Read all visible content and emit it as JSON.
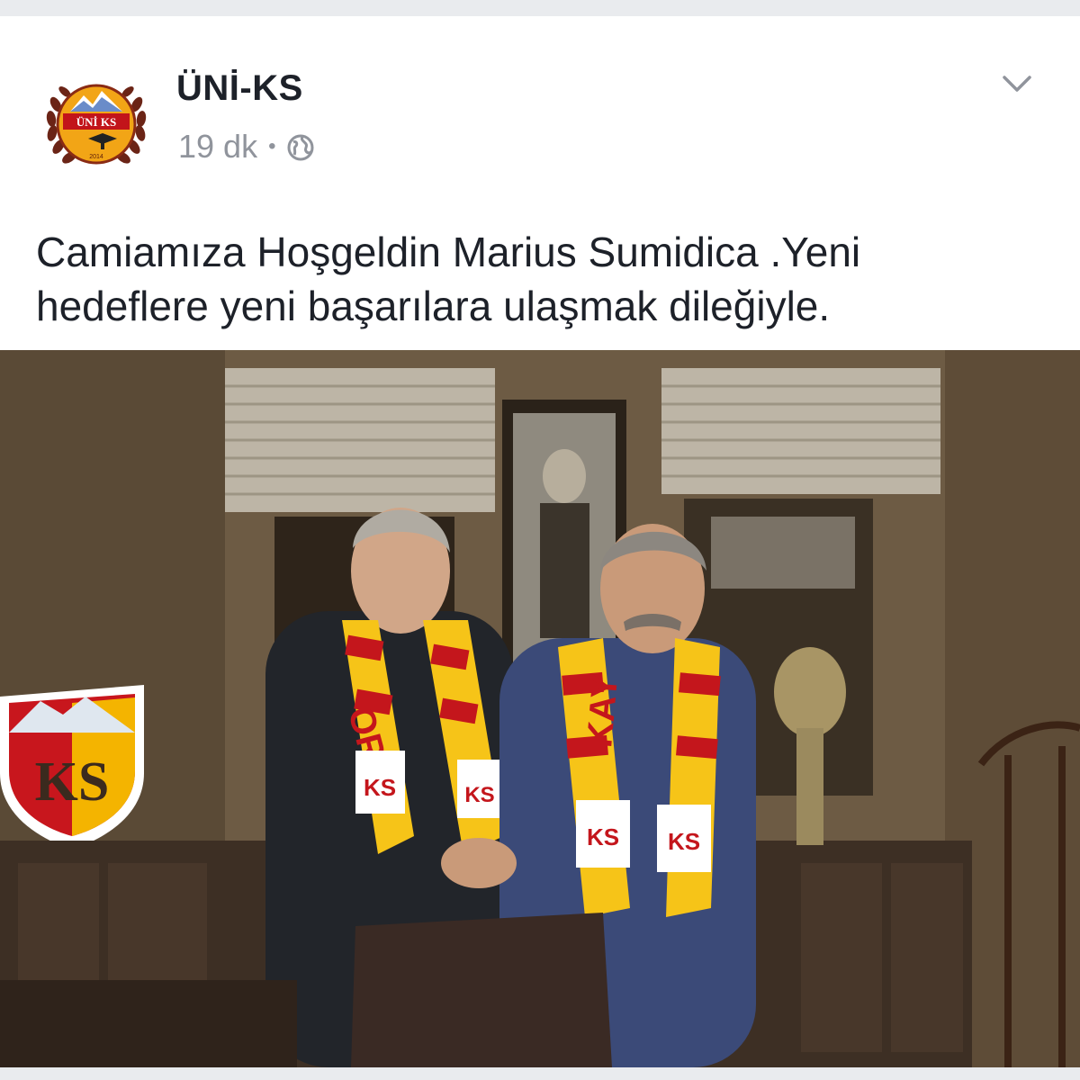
{
  "post": {
    "author": "ÜNİ-KS",
    "timestamp": "19 dk",
    "separator": "•",
    "privacy_icon": "globe-icon",
    "menu_icon": "chevron-down-icon",
    "caption": "Camiamıza Hoşgeldin Marius Sumidica .Yeni hedeflere yeni başarılara ulaşmak dileğiyle.",
    "avatar": {
      "badge_text": "ÜNİ KS",
      "year": "2014"
    },
    "photo": {
      "crest_text": "KS",
      "scarf_text_left": "OR",
      "scarf_text_right": "KAY",
      "scarf_badge": "KS"
    }
  },
  "colors": {
    "text": "#1d2129",
    "meta": "#90949c",
    "scarf_red": "#c4161c",
    "scarf_yellow": "#f6c418"
  }
}
